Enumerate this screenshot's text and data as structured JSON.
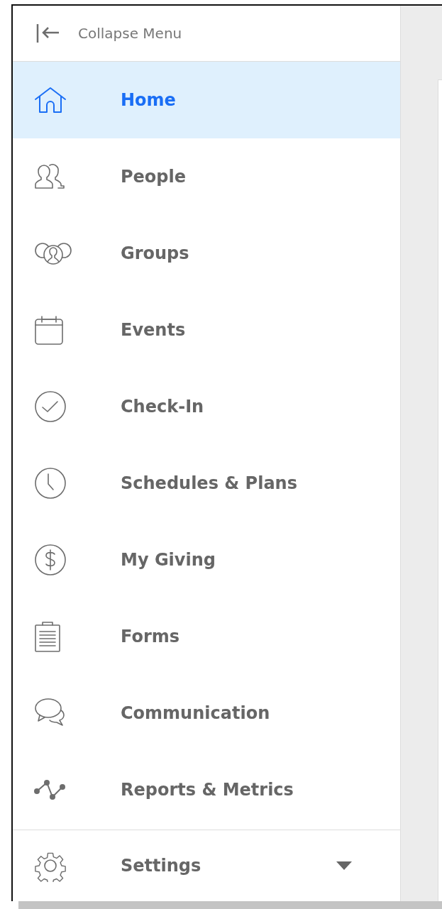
{
  "collapse": {
    "label": "Collapse Menu"
  },
  "items": [
    {
      "label": "Home",
      "selected": true
    },
    {
      "label": "People",
      "selected": false
    },
    {
      "label": "Groups",
      "selected": false
    },
    {
      "label": "Events",
      "selected": false
    },
    {
      "label": "Check-In",
      "selected": false
    },
    {
      "label": "Schedules & Plans",
      "selected": false
    },
    {
      "label": "My Giving",
      "selected": false
    },
    {
      "label": "Forms",
      "selected": false
    },
    {
      "label": "Communication",
      "selected": false
    },
    {
      "label": "Reports & Metrics",
      "selected": false
    }
  ],
  "settings": {
    "label": "Settings",
    "selected": false
  }
}
